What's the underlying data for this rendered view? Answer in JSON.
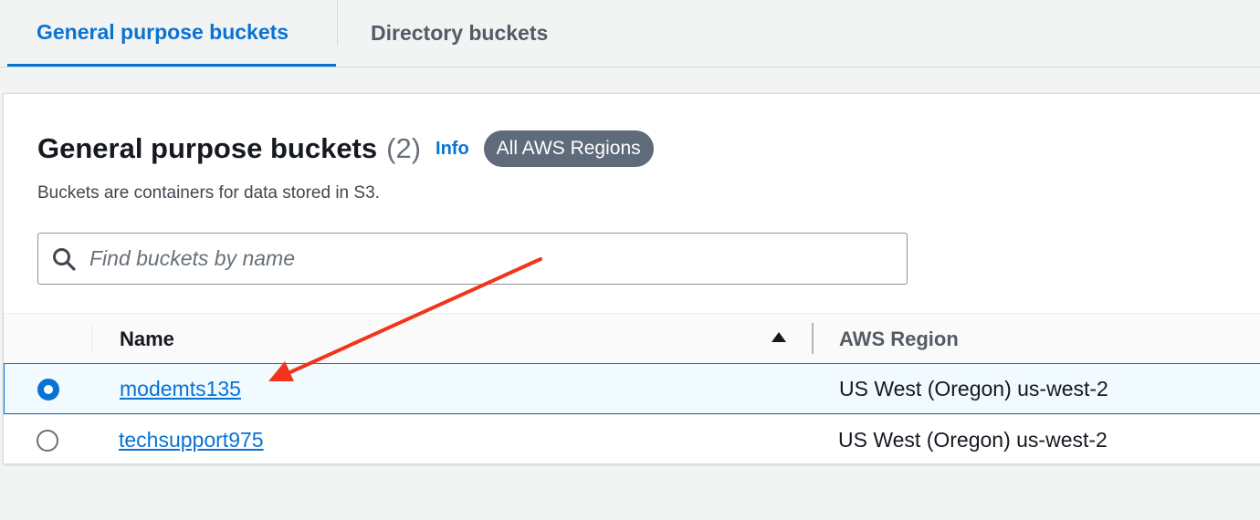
{
  "tabs": {
    "general": "General purpose buckets",
    "directory": "Directory buckets"
  },
  "panel": {
    "title": "General purpose buckets",
    "count": "(2)",
    "info": "Info",
    "region_badge": "All AWS Regions",
    "description": "Buckets are containers for data stored in S3."
  },
  "search": {
    "placeholder": "Find buckets by name",
    "value": ""
  },
  "table": {
    "columns": [
      "Name",
      "AWS Region"
    ],
    "sort": "ascending",
    "rows": [
      {
        "name": "modemts135",
        "region": "US West (Oregon) us-west-2",
        "selected": true
      },
      {
        "name": "techsupport975",
        "region": "US West (Oregon) us-west-2",
        "selected": false
      }
    ]
  },
  "colors": {
    "accent": "#0972d3",
    "annotation_arrow": "#f0351a",
    "badge": "#5f6b7a"
  },
  "icons": [
    "search-icon",
    "sort-ascending-icon",
    "radio-selected-icon",
    "radio-unselected-icon"
  ]
}
